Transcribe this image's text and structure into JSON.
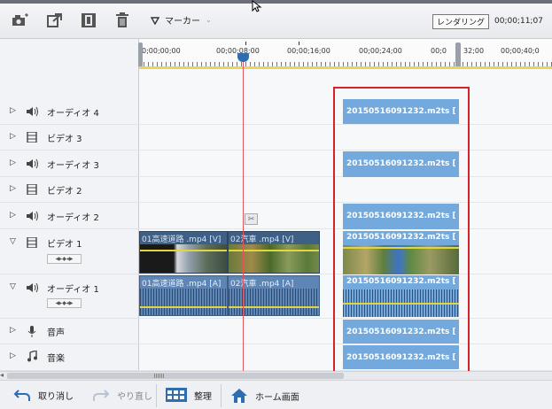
{
  "toolbar": {
    "icons": [
      "snapshot-camera-icon",
      "export-arrow-icon",
      "save-icon",
      "trash-icon"
    ],
    "marker_label": "マーカー",
    "render_label": "レンダリング",
    "timecode": "00;00;11;07"
  },
  "ruler": {
    "ticks": [
      "0;00;00;00",
      "00;00;08;00",
      "00;00;16;00",
      "00;00;24;00",
      "00;0",
      "32;00",
      "00;00;40;0"
    ]
  },
  "tracks": [
    {
      "name": "オーディオ 4",
      "kind": "audio"
    },
    {
      "name": "ビデオ 3",
      "kind": "video"
    },
    {
      "name": "オーディオ 3",
      "kind": "audio"
    },
    {
      "name": "ビデオ 2",
      "kind": "video"
    },
    {
      "name": "オーディオ 2",
      "kind": "audio"
    },
    {
      "name": "ビデオ 1",
      "kind": "video"
    },
    {
      "name": "オーディオ 1",
      "kind": "audio"
    },
    {
      "name": "音声",
      "kind": "voice"
    },
    {
      "name": "音楽",
      "kind": "music"
    }
  ],
  "clips": {
    "m2ts": "20150516091232.m2ts [",
    "v1a": "01高速道路 .mp4 [V]",
    "v1b": "02汽車 .mp4 [V]",
    "a1a": "01高速道路 .mp4 [A]",
    "a1b": "02汽車 .mp4 [A]"
  },
  "bottom": {
    "undo": "取り消し",
    "redo": "やり直し",
    "organize": "整理",
    "home": "ホーム画面"
  },
  "colors": {
    "clip_blue": "#73a9dc",
    "selection_red": "#d92128",
    "playhead": "#e2555e"
  }
}
